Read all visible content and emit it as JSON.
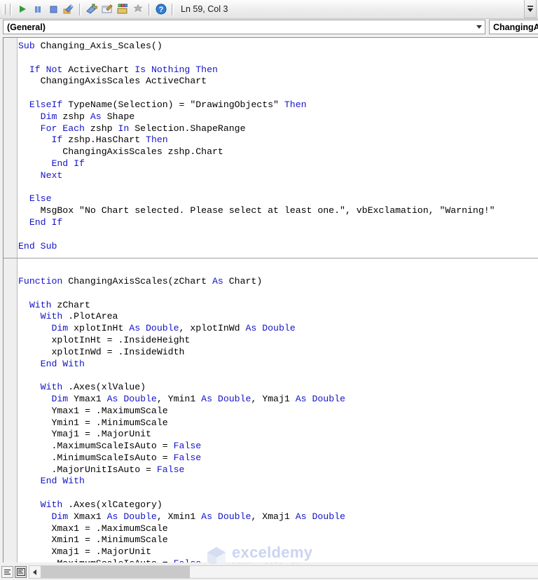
{
  "toolbar": {
    "buttons": [
      {
        "name": "run-macro-button",
        "icon": "play-icon",
        "label": "Run Sub/UserForm"
      },
      {
        "name": "break-button",
        "icon": "pause-icon",
        "label": "Break"
      },
      {
        "name": "reset-button",
        "icon": "stop-icon",
        "label": "Reset"
      },
      {
        "name": "design-mode-button",
        "icon": "design-mode-icon",
        "label": "Design Mode"
      },
      {
        "name": "project-explorer-button",
        "icon": "project-explorer-icon",
        "label": "Project Explorer"
      },
      {
        "name": "properties-window-button",
        "icon": "properties-window-icon",
        "label": "Properties Window"
      },
      {
        "name": "object-browser-button",
        "icon": "object-browser-icon",
        "label": "Object Browser"
      },
      {
        "name": "toolbox-button",
        "icon": "toolbox-icon",
        "label": "Toolbox"
      },
      {
        "name": "help-button",
        "icon": "help-icon",
        "label": "Microsoft Visual Basic for Applications Help"
      }
    ],
    "status": "Ln 59, Col 3",
    "overflow_label": "Toolbar Options"
  },
  "dropdowns": {
    "object_box": {
      "value": "(General)",
      "placeholder": "(General)"
    },
    "procedure_box": {
      "value": "ChangingAx",
      "placeholder": "ChangingAxisScales"
    }
  },
  "code": {
    "lines": [
      [
        {
          "t": "Sub ",
          "k": true
        },
        {
          "t": "Changing_Axis_Scales()",
          "k": false
        }
      ],
      [],
      [
        {
          "t": "  If Not ",
          "k": true
        },
        {
          "t": "ActiveChart ",
          "k": false
        },
        {
          "t": "Is Nothing Then",
          "k": true
        }
      ],
      [
        {
          "t": "    ChangingAxisScales ActiveChart",
          "k": false
        }
      ],
      [],
      [
        {
          "t": "  ElseIf ",
          "k": true
        },
        {
          "t": "TypeName(Selection) = \"DrawingObjects\" ",
          "k": false
        },
        {
          "t": "Then",
          "k": true
        }
      ],
      [
        {
          "t": "    Dim ",
          "k": true
        },
        {
          "t": "zshp ",
          "k": false
        },
        {
          "t": "As ",
          "k": true
        },
        {
          "t": "Shape",
          "k": false
        }
      ],
      [
        {
          "t": "    For Each ",
          "k": true
        },
        {
          "t": "zshp ",
          "k": false
        },
        {
          "t": "In ",
          "k": true
        },
        {
          "t": "Selection.ShapeRange",
          "k": false
        }
      ],
      [
        {
          "t": "      If ",
          "k": true
        },
        {
          "t": "zshp.HasChart ",
          "k": false
        },
        {
          "t": "Then",
          "k": true
        }
      ],
      [
        {
          "t": "        ChangingAxisScales zshp.Chart",
          "k": false
        }
      ],
      [
        {
          "t": "      End If",
          "k": true
        }
      ],
      [
        {
          "t": "    Next",
          "k": true
        }
      ],
      [],
      [
        {
          "t": "  Else",
          "k": true
        }
      ],
      [
        {
          "t": "    MsgBox \"No Chart selected. Please select at least one.\", vbExclamation, \"Warning!\"",
          "k": false
        }
      ],
      [
        {
          "t": "  End If",
          "k": true
        }
      ],
      [],
      [
        {
          "t": "End Sub",
          "k": true
        }
      ],
      [
        "SEPARATOR"
      ],
      [],
      [
        {
          "t": "Function ",
          "k": true
        },
        {
          "t": "ChangingAxisScales(zChart ",
          "k": false
        },
        {
          "t": "As ",
          "k": true
        },
        {
          "t": "Chart)",
          "k": false
        }
      ],
      [],
      [
        {
          "t": "  With ",
          "k": true
        },
        {
          "t": "zChart",
          "k": false
        }
      ],
      [
        {
          "t": "    With ",
          "k": true
        },
        {
          "t": ".PlotArea",
          "k": false
        }
      ],
      [
        {
          "t": "      Dim ",
          "k": true
        },
        {
          "t": "xplotInHt ",
          "k": false
        },
        {
          "t": "As Double",
          "k": true
        },
        {
          "t": ", xplotInWd ",
          "k": false
        },
        {
          "t": "As Double",
          "k": true
        }
      ],
      [
        {
          "t": "      xplotInHt = .InsideHeight",
          "k": false
        }
      ],
      [
        {
          "t": "      xplotInWd = .InsideWidth",
          "k": false
        }
      ],
      [
        {
          "t": "    End With",
          "k": true
        }
      ],
      [],
      [
        {
          "t": "    With ",
          "k": true
        },
        {
          "t": ".Axes(xlValue)",
          "k": false
        }
      ],
      [
        {
          "t": "      Dim ",
          "k": true
        },
        {
          "t": "Ymax1 ",
          "k": false
        },
        {
          "t": "As Double",
          "k": true
        },
        {
          "t": ", Ymin1 ",
          "k": false
        },
        {
          "t": "As Double",
          "k": true
        },
        {
          "t": ", Ymaj1 ",
          "k": false
        },
        {
          "t": "As Double",
          "k": true
        }
      ],
      [
        {
          "t": "      Ymax1 = .MaximumScale",
          "k": false
        }
      ],
      [
        {
          "t": "      Ymin1 = .MinimumScale",
          "k": false
        }
      ],
      [
        {
          "t": "      Ymaj1 = .MajorUnit",
          "k": false
        }
      ],
      [
        {
          "t": "      .MaximumScaleIsAuto = ",
          "k": false
        },
        {
          "t": "False",
          "k": true
        }
      ],
      [
        {
          "t": "      .MinimumScaleIsAuto = ",
          "k": false
        },
        {
          "t": "False",
          "k": true
        }
      ],
      [
        {
          "t": "      .MajorUnitIsAuto = ",
          "k": false
        },
        {
          "t": "False",
          "k": true
        }
      ],
      [
        {
          "t": "    End With",
          "k": true
        }
      ],
      [],
      [
        {
          "t": "    With ",
          "k": true
        },
        {
          "t": ".Axes(xlCategory)",
          "k": false
        }
      ],
      [
        {
          "t": "      Dim ",
          "k": true
        },
        {
          "t": "Xmax1 ",
          "k": false
        },
        {
          "t": "As Double",
          "k": true
        },
        {
          "t": ", Xmin1 ",
          "k": false
        },
        {
          "t": "As Double",
          "k": true
        },
        {
          "t": ", Xmaj1 ",
          "k": false
        },
        {
          "t": "As Double",
          "k": true
        }
      ],
      [
        {
          "t": "      Xmax1 = .MaximumScale",
          "k": false
        }
      ],
      [
        {
          "t": "      Xmin1 = .MinimumScale",
          "k": false
        }
      ],
      [
        {
          "t": "      Xmaj1 = .MajorUnit",
          "k": false
        }
      ],
      [
        {
          "t": "      .MaximumScaleIsAuto = ",
          "k": false
        },
        {
          "t": "False",
          "k": true
        }
      ]
    ]
  },
  "watermark": {
    "name": "exceldemy",
    "tagline": "EXCEL - DATA - BI"
  },
  "bottombar": {
    "procedure_view_label": "Procedure View",
    "full_module_view_label": "Full Module View",
    "scroll_left_label": "Scroll Left"
  },
  "colors": {
    "keyword": "#1414c8",
    "code_text": "#000000",
    "code_background": "#ffffff",
    "chrome": "#f0f0f0",
    "watermark": "#c3cdf0"
  }
}
